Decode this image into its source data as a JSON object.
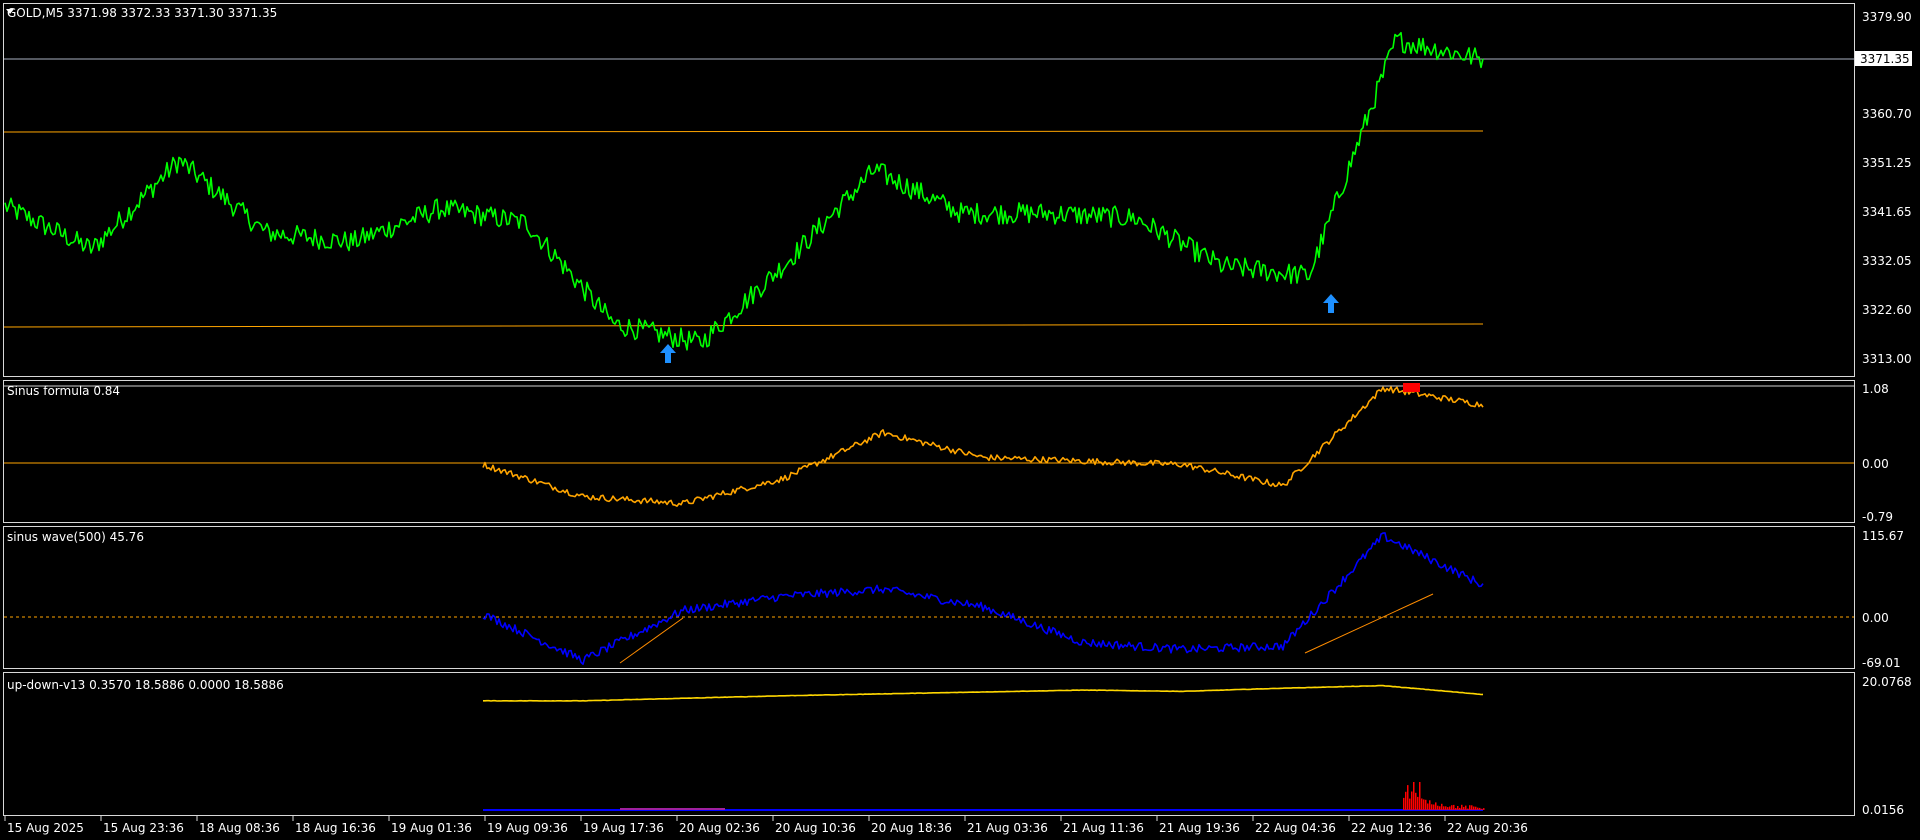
{
  "colors": {
    "background": "#000000",
    "frame": "#d8d8d8",
    "price_line": "#00ff00",
    "level_line": "#ffa500",
    "current_line": "#a8b0c0",
    "sinus_formula_line": "#ffa500",
    "sinus_wave_line": "#0000ff",
    "trendline": "#ff8c00",
    "updown_line": "#ffd700",
    "updown_bars": "#ff0000",
    "updown_base": "#0000ff",
    "arrow": "#1e90ff",
    "marker": "#ff0000"
  },
  "main": {
    "title": "GOLD,M5  3371.98 3372.33 3371.30 3371.35",
    "current_price_label": "3371.35",
    "y_ticks": [
      "3379.90",
      "3360.70",
      "3351.25",
      "3341.65",
      "3332.05",
      "3322.60",
      "3313.00"
    ]
  },
  "sinus_formula": {
    "title": "Sinus formula 0.84",
    "y_ticks": [
      "1.08",
      "0.00",
      "-0.79"
    ]
  },
  "sinus_wave": {
    "title": "sinus wave(500) 45.76",
    "y_ticks": [
      "115.67",
      "0.00",
      "-69.01"
    ]
  },
  "updown": {
    "title": "up-down-v13 0.3570 18.5886 0.0000 18.5886",
    "y_ticks": [
      "20.0768",
      "0.0156"
    ]
  },
  "x_axis": {
    "labels": [
      "15 Aug 2025",
      "15 Aug 23:36",
      "18 Aug 08:36",
      "18 Aug 16:36",
      "19 Aug 01:36",
      "19 Aug 09:36",
      "19 Aug 17:36",
      "20 Aug 02:36",
      "20 Aug 10:36",
      "20 Aug 18:36",
      "21 Aug 03:36",
      "21 Aug 11:36",
      "21 Aug 19:36",
      "22 Aug 04:36",
      "22 Aug 12:36",
      "22 Aug 20:36"
    ]
  },
  "chart_data": [
    {
      "type": "line",
      "title": "GOLD,M5",
      "ohlc_last": {
        "open": 3371.98,
        "high": 3372.33,
        "low": 3371.3,
        "close": 3371.35
      },
      "x": [
        "15 Aug 2025",
        "15 Aug 23:36",
        "18 Aug 08:36",
        "18 Aug 16:36",
        "19 Aug 01:36",
        "19 Aug 09:36",
        "19 Aug 17:36",
        "20 Aug 02:36",
        "20 Aug 10:36",
        "20 Aug 18:36",
        "21 Aug 03:36",
        "21 Aug 11:36",
        "21 Aug 19:36",
        "22 Aug 04:36",
        "22 Aug 12:36",
        "22 Aug 20:36"
      ],
      "series": [
        {
          "values": [
            3342.5,
            3333.5,
            3352.0,
            3337.0,
            3335.0,
            3342.0,
            3339.0,
            3318.0,
            3314.0,
            3331.0,
            3350.0,
            3341.0,
            3341.0,
            3340.0,
            3330.0,
            3328.0,
            3377.0,
            3373.0
          ]
        }
      ],
      "horizontal_levels": [
        3357.6,
        3320.4
      ],
      "current_price": 3371.35,
      "ylim": [
        3310.5,
        3382.0
      ]
    },
    {
      "type": "line",
      "title": "Sinus formula 0.84",
      "x": [
        "19 Aug 09:36",
        "19 Aug 17:36",
        "20 Aug 02:36",
        "20 Aug 10:36",
        "20 Aug 18:36",
        "21 Aug 03:36",
        "21 Aug 11:36",
        "21 Aug 19:36",
        "22 Aug 04:36",
        "22 Aug 12:36",
        "22 Aug 20:36"
      ],
      "series": [
        {
          "values": [
            0.0,
            -0.45,
            -0.55,
            -0.2,
            0.45,
            0.1,
            0.05,
            0.0,
            -0.3,
            1.08,
            0.84
          ]
        }
      ],
      "ylim": [
        -0.79,
        1.08
      ]
    },
    {
      "type": "line",
      "title": "sinus wave(500) 45.76",
      "x": [
        "19 Aug 09:36",
        "19 Aug 17:36",
        "20 Aug 02:36",
        "20 Aug 10:36",
        "20 Aug 18:36",
        "21 Aug 03:36",
        "21 Aug 11:36",
        "21 Aug 19:36",
        "22 Aug 04:36",
        "22 Aug 12:36",
        "22 Aug 20:36"
      ],
      "series": [
        {
          "values": [
            5,
            -60,
            10,
            30,
            40,
            15,
            -35,
            -45,
            -40,
            115,
            45.76
          ]
        }
      ],
      "ylim": [
        -69.01,
        115.67
      ]
    },
    {
      "type": "line",
      "title": "up-down-v13 0.3570 18.5886 0.0000 18.5886",
      "x": [
        "19 Aug 09:36",
        "19 Aug 17:36",
        "20 Aug 02:36",
        "20 Aug 10:36",
        "20 Aug 18:36",
        "21 Aug 03:36",
        "21 Aug 11:36",
        "21 Aug 19:36",
        "22 Aug 04:36",
        "22 Aug 12:36",
        "22 Aug 20:36"
      ],
      "series": [
        {
          "values": [
            17.6,
            17.6,
            18.0,
            18.4,
            18.7,
            19.0,
            19.3,
            19.1,
            19.6,
            20.0,
            18.6
          ]
        }
      ],
      "ylim": [
        0.0156,
        20.0768
      ]
    }
  ]
}
